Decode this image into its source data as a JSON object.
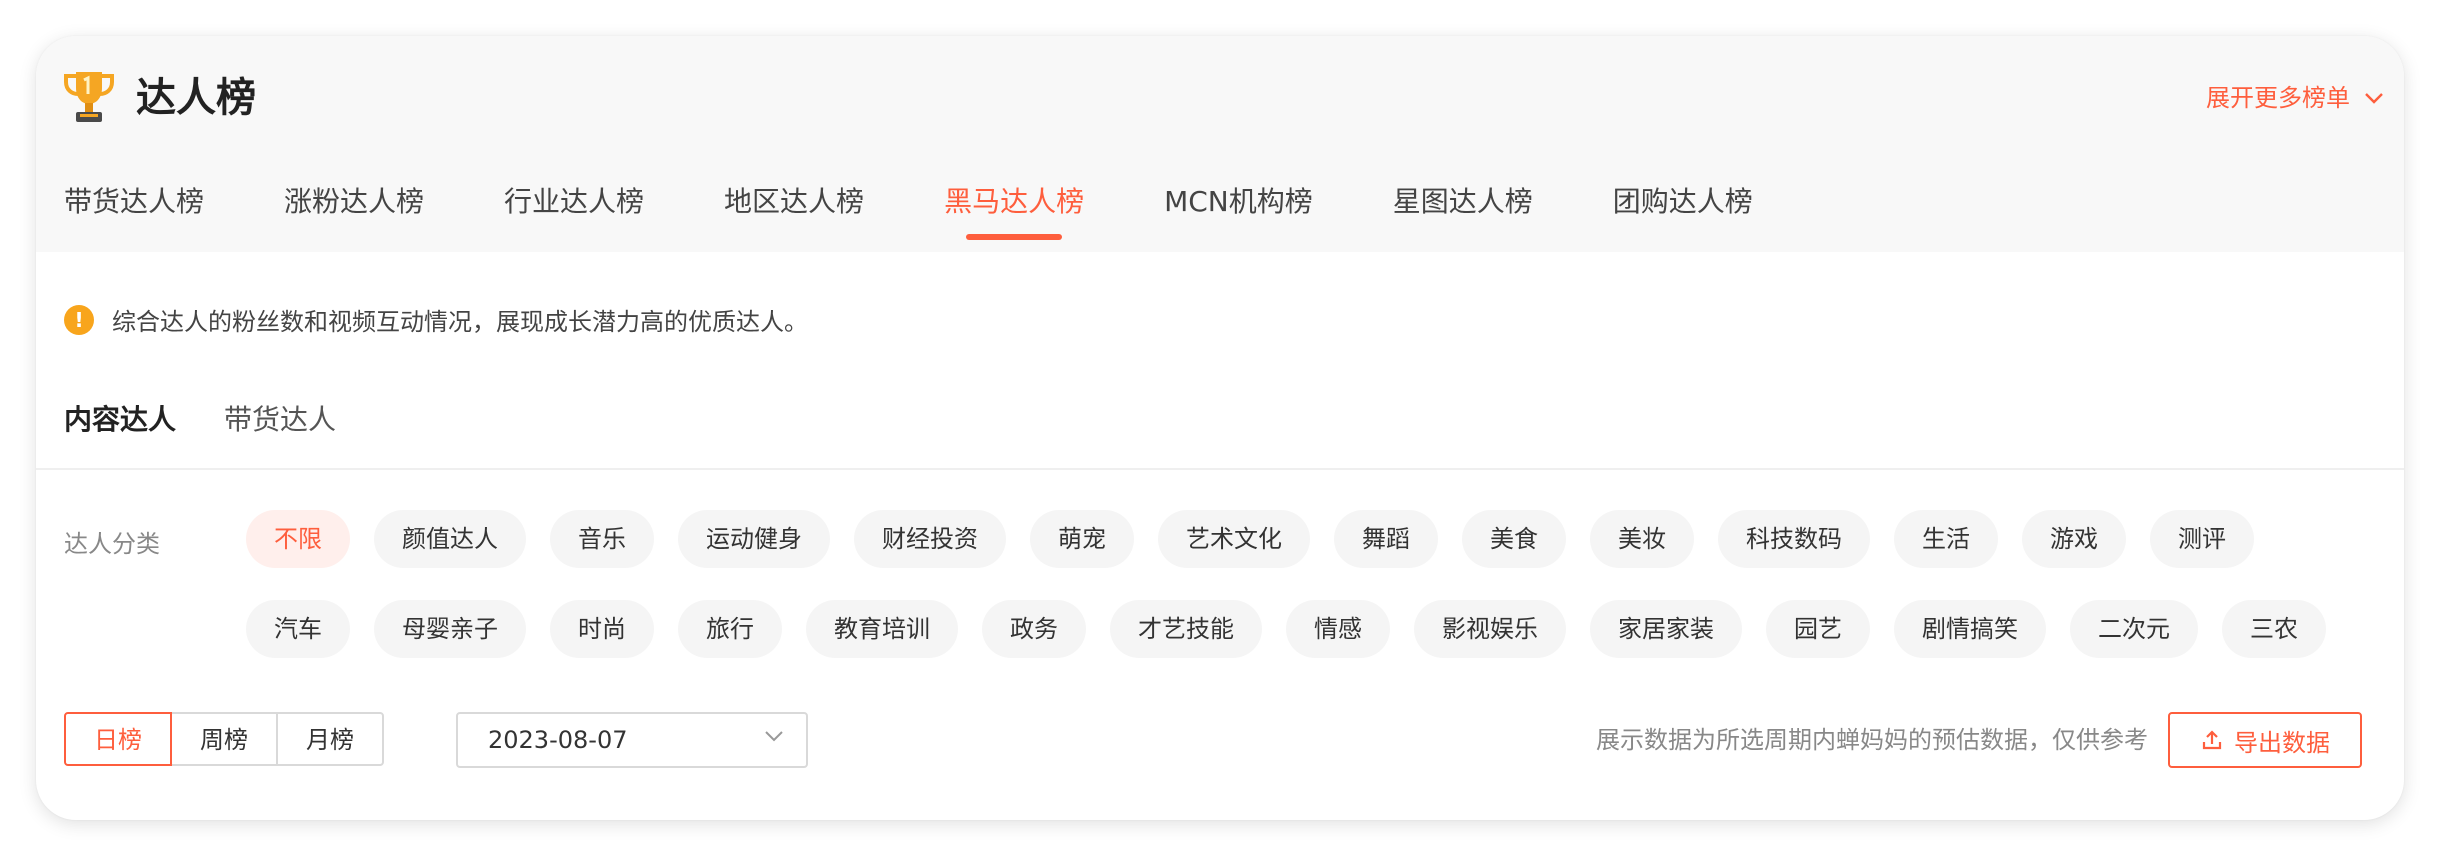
{
  "header": {
    "title": "达人榜",
    "expand_more": "展开更多榜单",
    "trophy_icon": "trophy-icon"
  },
  "main_tabs": [
    {
      "label": "带货达人榜",
      "active": false
    },
    {
      "label": "涨粉达人榜",
      "active": false
    },
    {
      "label": "行业达人榜",
      "active": false
    },
    {
      "label": "地区达人榜",
      "active": false
    },
    {
      "label": "黑马达人榜",
      "active": true
    },
    {
      "label": "MCN机构榜",
      "active": false
    },
    {
      "label": "星图达人榜",
      "active": false
    },
    {
      "label": "团购达人榜",
      "active": false
    }
  ],
  "notice": {
    "text": "综合达人的粉丝数和视频互动情况，展现成长潜力高的优质达人。",
    "icon": "!"
  },
  "sub_tabs": [
    {
      "label": "内容达人",
      "active": true
    },
    {
      "label": "带货达人",
      "active": false
    }
  ],
  "category": {
    "label": "达人分类",
    "row1": [
      "不限",
      "颜值达人",
      "音乐",
      "运动健身",
      "财经投资",
      "萌宠",
      "艺术文化",
      "舞蹈",
      "美食",
      "美妆",
      "科技数码",
      "生活",
      "游戏",
      "测评"
    ],
    "row2": [
      "汽车",
      "母婴亲子",
      "时尚",
      "旅行",
      "教育培训",
      "政务",
      "才艺技能",
      "情感",
      "影视娱乐",
      "家居家装",
      "园艺",
      "剧情搞笑",
      "二次元",
      "三农"
    ],
    "selected": "不限"
  },
  "period": {
    "options": [
      "日榜",
      "周榜",
      "月榜"
    ],
    "selected": "日榜"
  },
  "date": {
    "value": "2023-08-07"
  },
  "data_note": "展示数据为所选周期内蝉妈妈的预估数据，仅供参考",
  "export_label": "导出数据",
  "colors": {
    "accent": "#fe5e3d",
    "warning": "#f8a51c",
    "chip_bg": "#f5f5f5",
    "chip_active_bg": "#ffefec"
  }
}
